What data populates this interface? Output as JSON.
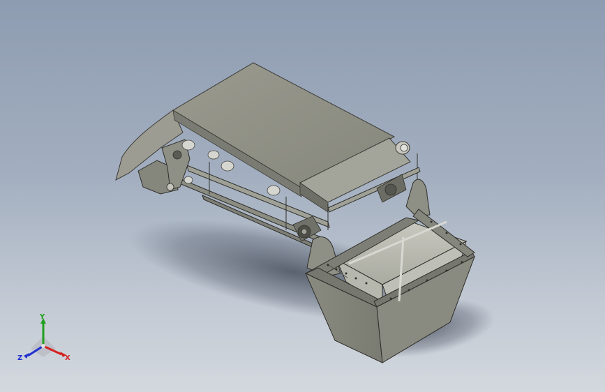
{
  "viewport": {
    "background_top": "#8e9cb1",
    "background_bottom": "#d3d8de",
    "model_color": "#8f8f84"
  },
  "triad": {
    "x_label": "X",
    "y_label": "Y",
    "z_label": "Z",
    "x_color": "#d42020",
    "y_color": "#20a020",
    "z_color": "#2030d0"
  }
}
